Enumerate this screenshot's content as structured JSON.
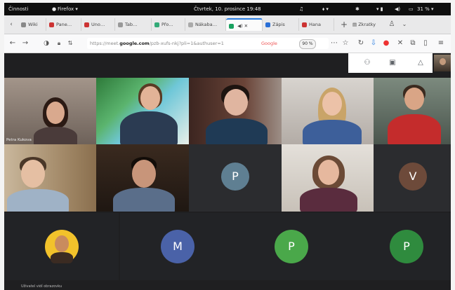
{
  "system_bar": {
    "activities": "Činnosti",
    "app_menu": "Firefox ▾",
    "clock": "Čtvrtek, 10. prosince 19:48",
    "battery": "31 % ▾"
  },
  "tabs": [
    {
      "label": "Wiki",
      "color": "#888"
    },
    {
      "label": "Pane…",
      "color": "#c33"
    },
    {
      "label": "Uno…",
      "color": "#c33"
    },
    {
      "label": "Tab…",
      "color": "#999"
    },
    {
      "label": "Přo…",
      "color": "#3a7"
    },
    {
      "label": "Nákaba…",
      "color": "#aaa"
    },
    {
      "label": "",
      "color": "#1aa260"
    },
    {
      "label": "Zápis",
      "color": "#2a6fd6"
    },
    {
      "label": "Hana",
      "color": "#c33"
    }
  ],
  "tab_extras": {
    "new_tab": "+",
    "bookmarks": "Zkratky"
  },
  "navbar": {
    "url_prefix": "https://meet.",
    "url_domain": "google.com",
    "url_rest": "/pzb-xufs-nkj?pli=1&authuser=1",
    "site_label": "Google",
    "zoom": "90 %"
  },
  "meeting": {
    "first_tile_name": "Petra Kukova",
    "avatars": [
      {
        "letter": "P",
        "color": "#5f7f92"
      },
      {
        "letter": "V",
        "color": "#6d4a3a"
      },
      {
        "letter": "M",
        "color": "#4a62a8"
      },
      {
        "letter": "P",
        "color": "#4aa84a"
      },
      {
        "letter": "P",
        "color": "#2f8b3e"
      }
    ],
    "bottom_caption": "Uživatel vidí obrazovku"
  }
}
